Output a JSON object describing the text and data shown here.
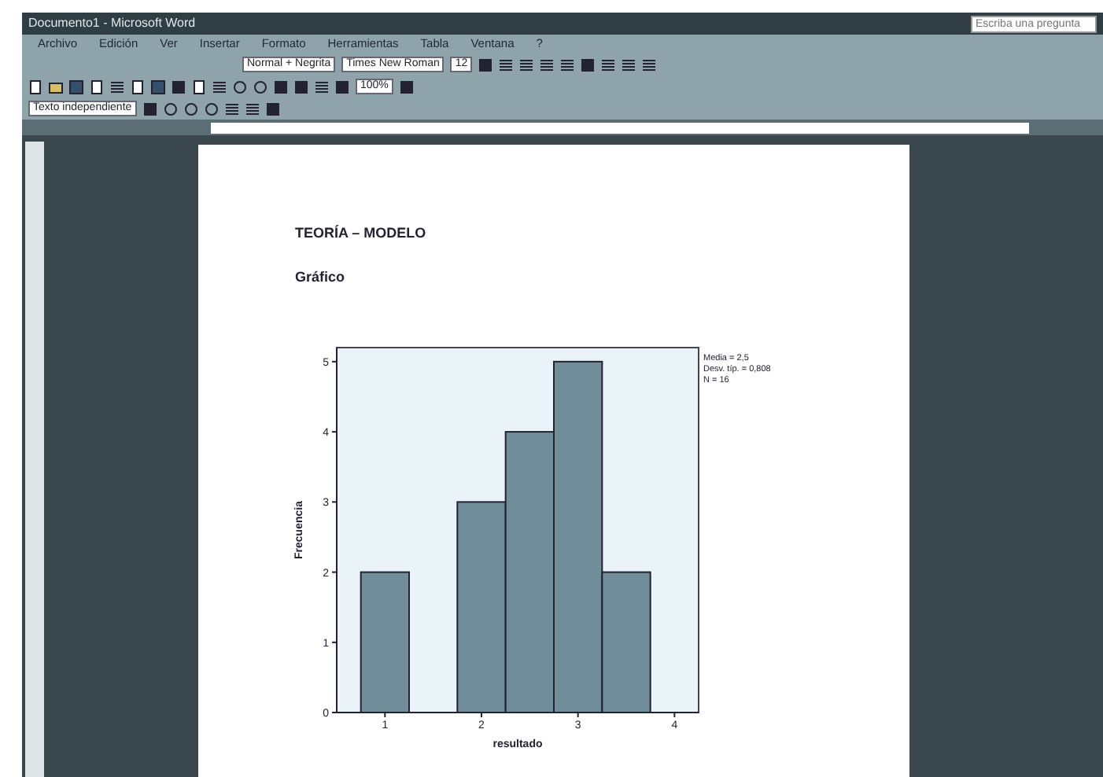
{
  "window": {
    "title": "Documento1 - Microsoft Word"
  },
  "help_box": {
    "placeholder": "Escriba una pregunta"
  },
  "menu": [
    "Archivo",
    "Edición",
    "Ver",
    "Insertar",
    "Formato",
    "Herramientas",
    "Tabla",
    "Ventana",
    "?"
  ],
  "format_toolbar": {
    "style": "Normal + Negrita",
    "font": "Times New Roman",
    "size": "12"
  },
  "standard_toolbar": {
    "zoom": "100%"
  },
  "outline_toolbar": {
    "level": "Texto independiente"
  },
  "document": {
    "heading": "TEORÍA – MODELO",
    "subheading": "Gráfico",
    "chart_data": {
      "type": "bar",
      "xlabel": "resultado",
      "ylabel": "Frecuencia",
      "x": [
        1,
        1.5,
        2,
        2.5,
        3,
        3.5
      ],
      "xlim": [
        0.5,
        4.25
      ],
      "ylim": [
        0,
        5.2
      ],
      "series": [
        {
          "color": "#6f8e9a",
          "values": [
            2,
            0,
            3,
            4,
            5,
            2
          ]
        }
      ],
      "xticks": [
        {
          "value": 1,
          "label": "1"
        },
        {
          "value": 2,
          "label": "2"
        },
        {
          "value": 3,
          "label": "3"
        },
        {
          "value": 4,
          "label": "4"
        }
      ],
      "yticks": [
        0,
        1,
        2,
        3,
        4,
        5
      ],
      "annotations": [
        "Media = 2,5",
        "Desv. típ. = 0,808",
        "N = 16"
      ]
    }
  }
}
